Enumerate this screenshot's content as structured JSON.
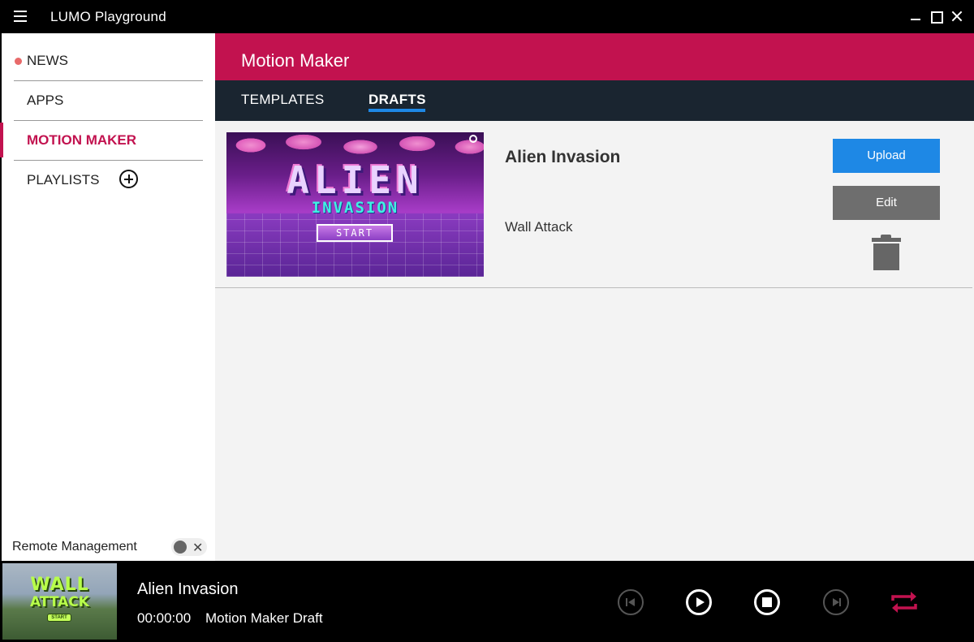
{
  "app": {
    "title": "LUMO Playground"
  },
  "sidebar": {
    "items": [
      {
        "label": "NEWS",
        "has_notification": true
      },
      {
        "label": "APPS"
      },
      {
        "label": "MOTION MAKER",
        "active": true
      },
      {
        "label": "PLAYLISTS"
      }
    ],
    "remote_management_label": "Remote Management",
    "remote_management_enabled": false
  },
  "main": {
    "title": "Motion Maker",
    "tabs": [
      {
        "label": "TEMPLATES"
      },
      {
        "label": "DRAFTS",
        "active": true
      }
    ],
    "drafts": [
      {
        "title": "Alien Invasion",
        "template": "Wall Attack",
        "thumbnail_line1": "ALIEN",
        "thumbnail_line2": "INVASION",
        "thumbnail_button": "START",
        "upload_label": "Upload",
        "edit_label": "Edit"
      }
    ]
  },
  "player": {
    "title": "Alien Invasion",
    "time": "00:00:00",
    "type": "Motion Maker Draft",
    "thumbnail_line1": "WALL",
    "thumbnail_line2": "ATTACK",
    "thumbnail_button": "START"
  },
  "colors": {
    "accent": "#c2124f",
    "tab_bar": "#1a2530",
    "primary_button": "#1e88e5",
    "secondary_button": "#6e6e6e",
    "notification_dot": "#e86a6a"
  }
}
